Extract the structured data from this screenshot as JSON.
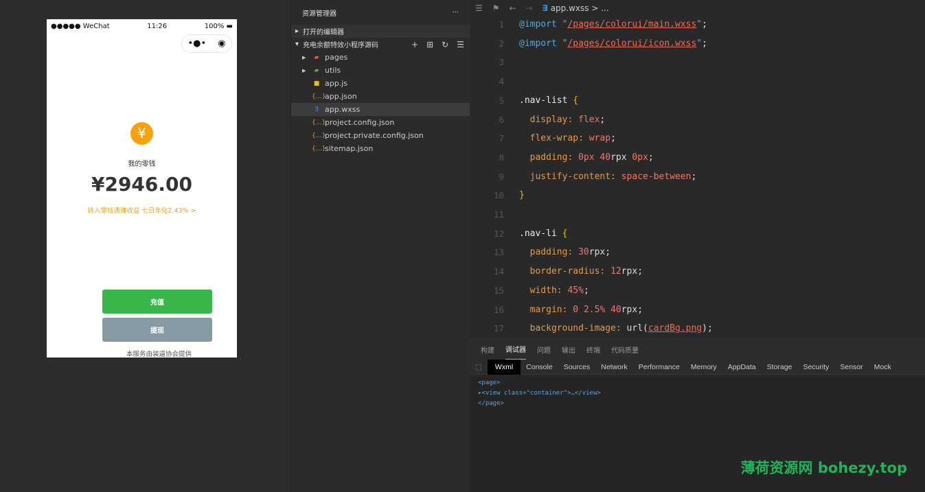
{
  "simulator": {
    "status": {
      "carrier": "●●●●● WeChat",
      "time": "11:26",
      "battery": "100%"
    },
    "capsule": {
      "more": "•●•",
      "close": "◉"
    },
    "coin_icon": "¥",
    "balance_label": "我的零钱",
    "balance": "¥2946.00",
    "promo": "转入零钱通赚收益 七日年化2.43% >",
    "recharge_button": "充值",
    "withdraw_button": "提现",
    "footer": "本服务由装逼协会提供",
    "colors": {
      "coin": "#f7a10b",
      "recharge": "#39b54a",
      "withdraw": "#8799a3",
      "promo": "#f7a10b"
    }
  },
  "explorer": {
    "title": "资源管理器",
    "more": "···",
    "open_editors": "打开的编辑器",
    "project": "充电余额特效小程序源码",
    "tools": [
      "+",
      "⊞",
      "↻",
      "☰"
    ],
    "files": [
      {
        "name": "pages",
        "icon": "folder-red",
        "type": "folder"
      },
      {
        "name": "utils",
        "icon": "folder-green",
        "type": "folder"
      },
      {
        "name": "app.js",
        "icon": "js",
        "type": "file"
      },
      {
        "name": "app.json",
        "icon": "json",
        "type": "file"
      },
      {
        "name": "app.wxss",
        "icon": "css",
        "type": "file",
        "selected": true
      },
      {
        "name": "project.config.json",
        "icon": "json",
        "type": "file"
      },
      {
        "name": "project.private.config.json",
        "icon": "json",
        "type": "file"
      },
      {
        "name": "sitemap.json",
        "icon": "json",
        "type": "file"
      }
    ]
  },
  "editor": {
    "breadcrumb": "app.wxss > ...",
    "lines": [
      [
        [
          "@import ",
          "at"
        ],
        [
          "\"",
          "q"
        ],
        [
          "/pages/colorui/main.wxss",
          "str"
        ],
        [
          "\"",
          "q"
        ],
        [
          ";",
          "p"
        ]
      ],
      [
        [
          "@import ",
          "at"
        ],
        [
          "\"",
          "q"
        ],
        [
          "/pages/colorui/icon.wxss",
          "str"
        ],
        [
          "\"",
          "q"
        ],
        [
          ";",
          "p"
        ]
      ],
      [],
      [],
      [
        [
          ".nav-list ",
          "sel"
        ],
        [
          "{",
          "br"
        ]
      ],
      [
        [
          "  display: ",
          "prop"
        ],
        [
          "flex",
          "val"
        ],
        [
          ";",
          "p"
        ]
      ],
      [
        [
          "  flex-wrap: ",
          "prop"
        ],
        [
          "wrap",
          "val"
        ],
        [
          ";",
          "p"
        ]
      ],
      [
        [
          "  padding: ",
          "prop"
        ],
        [
          "0px 40",
          "val"
        ],
        [
          "rpx ",
          "p"
        ],
        [
          "0px",
          "val"
        ],
        [
          ";",
          "p"
        ]
      ],
      [
        [
          "  justify-content: ",
          "prop"
        ],
        [
          "space-between",
          "val"
        ],
        [
          ";",
          "p"
        ]
      ],
      [
        [
          "}",
          "br"
        ]
      ],
      [],
      [
        [
          ".nav-li ",
          "sel"
        ],
        [
          "{",
          "br"
        ]
      ],
      [
        [
          "  padding: ",
          "prop"
        ],
        [
          "30",
          "val"
        ],
        [
          "rpx;",
          "p"
        ]
      ],
      [
        [
          "  border-radius: ",
          "prop"
        ],
        [
          "12",
          "val"
        ],
        [
          "rpx;",
          "p"
        ]
      ],
      [
        [
          "  width: ",
          "prop"
        ],
        [
          "45%",
          "val"
        ],
        [
          ";",
          "p"
        ]
      ],
      [
        [
          "  margin: ",
          "prop"
        ],
        [
          "0 2.5% 40",
          "val"
        ],
        [
          "rpx;",
          "p"
        ]
      ],
      [
        [
          "  background-image: ",
          "prop"
        ],
        [
          "url(",
          "p"
        ],
        [
          "cardBg.png",
          "str"
        ],
        [
          ");",
          "p"
        ]
      ]
    ]
  },
  "panel": {
    "tabs": [
      "构建",
      "调试器",
      "问题",
      "输出",
      "终端",
      "代码质量"
    ],
    "active_tab": "调试器",
    "devtools": [
      "Wxml",
      "Console",
      "Sources",
      "Network",
      "Performance",
      "Memory",
      "AppData",
      "Storage",
      "Security",
      "Sensor",
      "Mock"
    ],
    "active_devtool": "Wxml",
    "wxml": [
      "<page>",
      "▸<view class=\"container\">…</view>",
      "</page>"
    ]
  },
  "watermark": "薄荷资源网 bohezy.top"
}
